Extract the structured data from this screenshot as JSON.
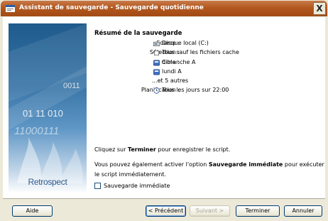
{
  "window": {
    "title": "Assistant de sauvegarde - Sauvegarde quotidienne",
    "close_glyph": "X"
  },
  "banner": {
    "logo": "Retrospect",
    "numbers": [
      "0011",
      "01 11 010",
      "11000111"
    ]
  },
  "summary": {
    "heading": "Résumé de la sauvegarde",
    "source_label": "Source :",
    "source_value": "Disque local (C:)",
    "selection_label": "Sélection :",
    "selection_value": "Tous sauf les fichiers cache",
    "target_label": "Cible :",
    "target_value_1": "dimanche A",
    "target_value_2": "lundi A",
    "target_more": "...et 5 autres",
    "schedule_label": "Planification :",
    "schedule_value": "Tous les jours sur 22:00"
  },
  "messages": {
    "finish_pre": "Cliquez sur ",
    "finish_bold": "Terminer",
    "finish_post": " pour enregistrer le script.",
    "immediate_pre": "Vous pouvez également activer l'option ",
    "immediate_bold": "Sauvegarde immédiate",
    "immediate_post": " pour exécuter",
    "immediate_line2": "le script immédiatement."
  },
  "checkbox": {
    "label": "Sauvegarde immédiate",
    "checked": false
  },
  "buttons": {
    "help": "Aide",
    "back": "< Précédent",
    "next": "Suivant >",
    "finish": "Terminer",
    "cancel": "Annuler"
  },
  "icons": [
    "window-icon",
    "disk-icon",
    "selector-icon",
    "backup-set-icon",
    "clock-icon",
    "close-icon"
  ]
}
